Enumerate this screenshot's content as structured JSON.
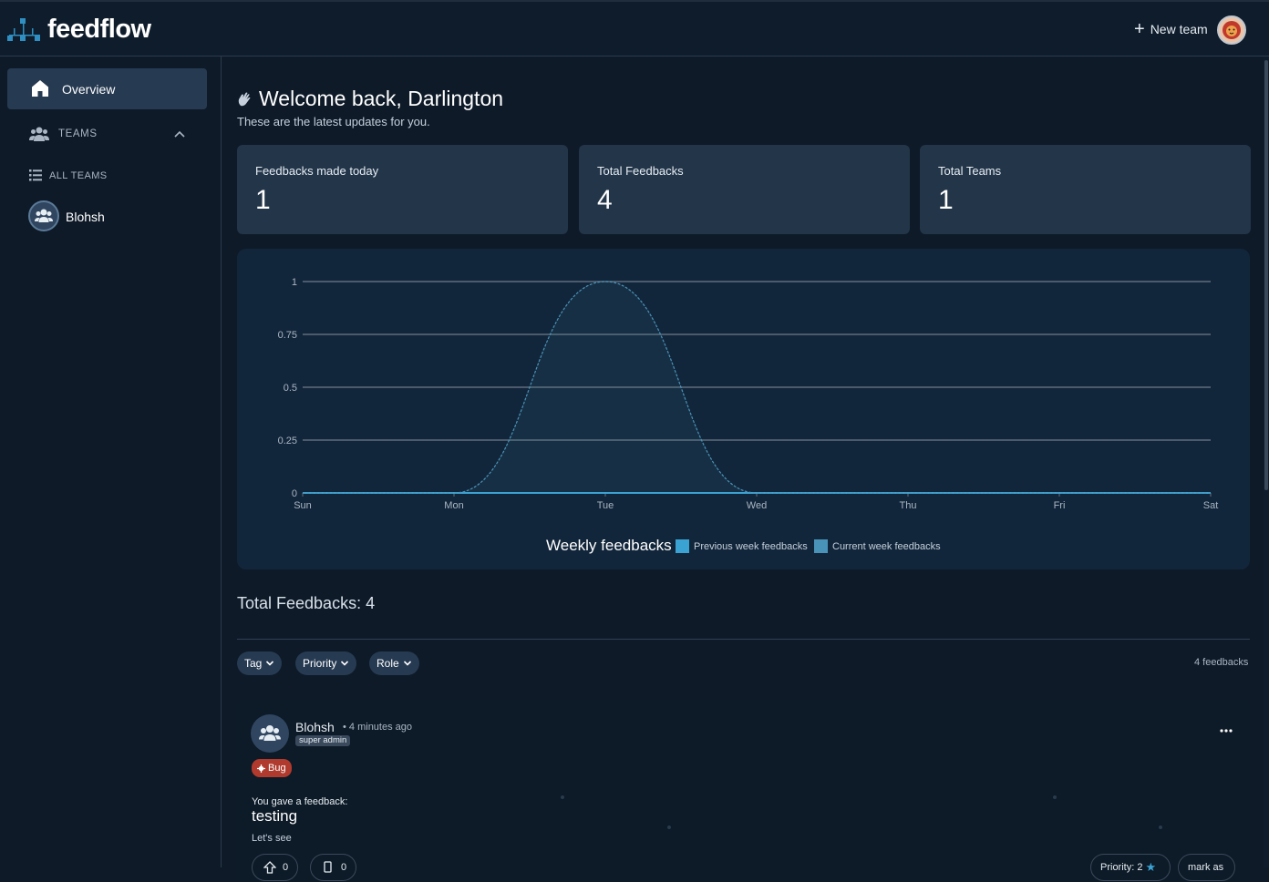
{
  "app": {
    "name": "feedflow"
  },
  "header": {
    "new_team_label": "New team"
  },
  "sidebar": {
    "overview_label": "Overview",
    "teams_label": "TEAMS",
    "all_teams_label": "ALL TEAMS",
    "teams": [
      {
        "label": "Blohsh"
      }
    ]
  },
  "welcome": {
    "title": "Welcome back, Darlington",
    "subtitle": "These are the latest updates for you."
  },
  "stats": [
    {
      "label": "Feedbacks made today",
      "value": "1"
    },
    {
      "label": "Total Feedbacks",
      "value": "4"
    },
    {
      "label": "Total Teams",
      "value": "1"
    }
  ],
  "chart_data": {
    "type": "area",
    "title": "Weekly feedbacks",
    "categories": [
      "Sun",
      "Mon",
      "Tue",
      "Wed",
      "Thu",
      "Fri",
      "Sat"
    ],
    "series": [
      {
        "name": "Previous week feedbacks",
        "values": [
          0,
          0,
          0,
          0,
          0,
          0,
          0
        ],
        "color": "#3aa3d4"
      },
      {
        "name": "Current week feedbacks",
        "values": [
          0,
          0,
          1,
          0,
          0,
          0,
          0
        ],
        "color": "#4a93b8"
      }
    ],
    "yticks": [
      "0",
      "0.25",
      "0.5",
      "0.75",
      "1"
    ],
    "ylim": [
      0,
      1
    ],
    "grid": true,
    "legend_position": "bottom"
  },
  "feedbacks": {
    "title": "Total Feedbacks: 4",
    "count_label": "4 feedbacks",
    "filters": [
      "Tag",
      "Priority",
      "Role"
    ]
  },
  "post": {
    "author": "Blohsh",
    "time": "• 4 minutes ago",
    "role": "super admin",
    "tag": "Bug",
    "kicker": "You gave a feedback:",
    "title": "testing",
    "body": "Let's see",
    "upvotes": "0",
    "comments": "0",
    "priority_label": "Priority: 2",
    "mark_label": "mark as"
  },
  "colors": {
    "accent": "#3aa3d4",
    "bug_tag": "#b03a2e",
    "card": "#233549"
  }
}
